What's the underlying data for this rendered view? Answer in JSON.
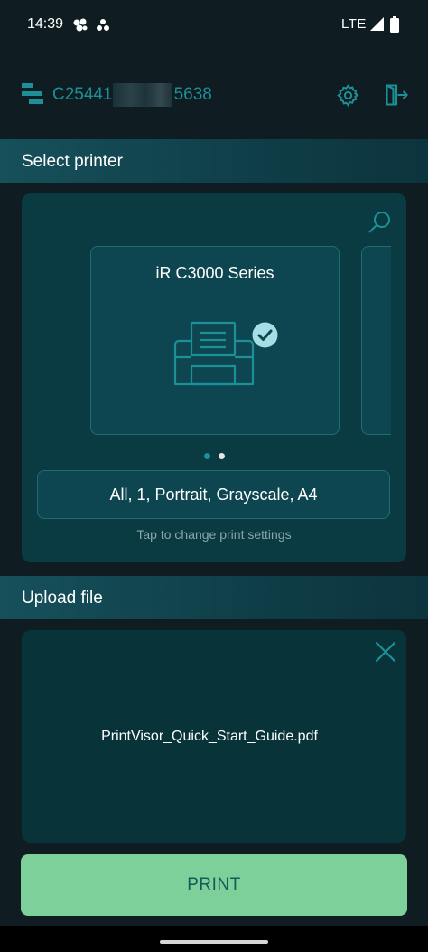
{
  "status_bar": {
    "time": "14:39",
    "network": "LTE",
    "icons": [
      "notification-dots-icon",
      "signal-icon",
      "battery-icon"
    ]
  },
  "header": {
    "device_id_prefix": "C25441",
    "device_id_suffix": "5638",
    "icons": [
      "logo-icon",
      "gear-icon",
      "logout-icon"
    ]
  },
  "select_printer": {
    "title": "Select printer",
    "printer_name": "iR C3000 Series",
    "page_indicator": {
      "count": 2,
      "active": 0
    },
    "settings_summary": "All, 1, Portrait, Grayscale, A4",
    "settings_hint": "Tap to change print settings"
  },
  "upload_file": {
    "title": "Upload file",
    "file_name": "PrintVisor_Quick_Start_Guide.pdf"
  },
  "print_button": {
    "label": "PRINT"
  },
  "colors": {
    "background": "#0f1d22",
    "accent_teal": "#1d8f97",
    "card": "#0a3a42",
    "print_button": "#7dd09a",
    "print_text": "#155a56"
  }
}
